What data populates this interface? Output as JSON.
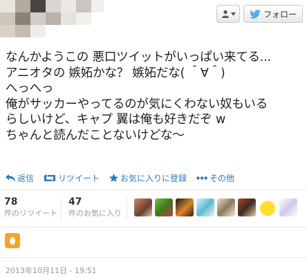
{
  "header": {
    "user_menu_icon": "user-dropdown-icon",
    "follow_label": "フォロー",
    "follow_icon": "twitter-bird-icon"
  },
  "tweet": {
    "lines": [
      "なんかようこの 悪口ツイットがいっぱい来てる...",
      "アニオタの 嫉妬かな？ 嫉妬だな( ＾∀＾)",
      "へっへっ",
      "俺がサッカーやってるのが気にくわない奴もいる",
      "らしいけど、キャプ 翼は俺も好きだぞ w",
      "ちゃんと読んだことないけどな～"
    ]
  },
  "actions": {
    "reply": "返信",
    "retweet": "リツイート",
    "favorite": "お気に入りに登録",
    "more": "その他"
  },
  "stats": {
    "retweets_count": "78",
    "retweets_label": "件のリツイート",
    "favorites_count": "47",
    "favorites_label": "件のお気に入り"
  },
  "timestamp": "2013年10月11日 - 19:51",
  "colors": {
    "link": "#2b7bb9",
    "app_icon": "#f4a523",
    "bird": "#55acee"
  }
}
